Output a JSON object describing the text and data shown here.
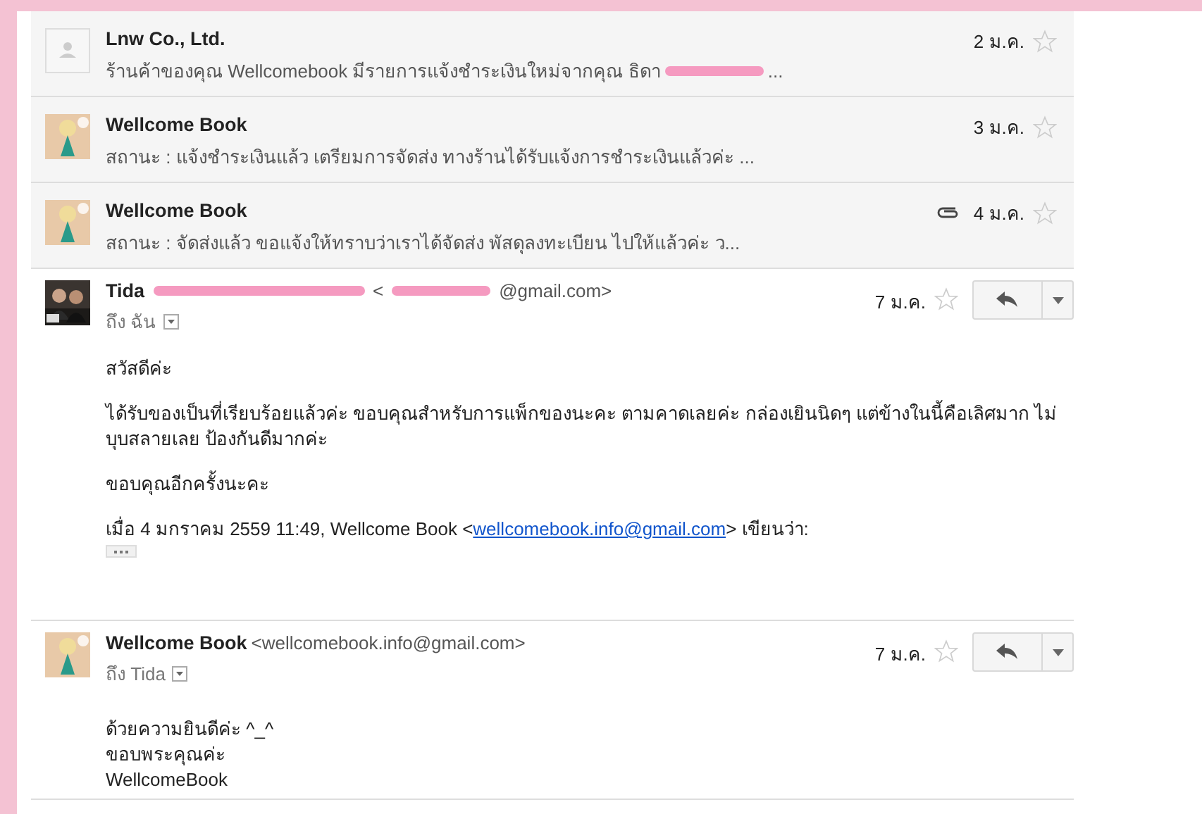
{
  "collapsed": [
    {
      "kind": "placeholder",
      "sender": "Lnw Co., Ltd.",
      "snippet_parts": [
        "ร้านค้าของคุณ Wellcomebook มีรายการแจ้งชำระเงินใหม่จากคุณ ธิดา",
        "..."
      ],
      "attachment": false,
      "date": "2 ม.ค.",
      "starred": false
    },
    {
      "kind": "character",
      "sender": "Wellcome Book",
      "snippet_parts": [
        "สถานะ : แจ้งชำระเงินแล้ว เตรียมการจัดส่ง ทางร้านได้รับแจ้งการชำระเงินแล้วค่ะ ..."
      ],
      "attachment": false,
      "date": "3 ม.ค.",
      "starred": false
    },
    {
      "kind": "character",
      "sender": "Wellcome Book",
      "snippet_parts": [
        "สถานะ : จัดส่งแล้ว ขอแจ้งให้ทราบว่าเราได้จัดส่ง พัสดุลงทะเบียน ไปให้แล้วค่ะ ว..."
      ],
      "attachment": true,
      "date": "4 ม.ค.",
      "starred": false
    }
  ],
  "expanded": [
    {
      "sender": "Tida",
      "sender_redacted": true,
      "email_parts": [
        "<",
        "@gmail.com>"
      ],
      "recipient": "ถึง ฉัน",
      "date": "7 ม.ค.",
      "starred": false,
      "paragraphs": [
        [
          "สวัสดีค่ะ"
        ],
        [
          "ได้รับของเป็นที่เรียบร้อยแล้วค่ะ ขอบคุณสำหรับการแพ็กของนะคะ ตามคาดเลยค่ะ กล่องเยินนิดๆ แต่ข้างในนี้คือเลิศมาก ไม่บุบสลายเลย ป้องกันดีมากค่ะ"
        ],
        [
          "ขอบคุณอีกครั้งนะคะ"
        ]
      ],
      "quote": {
        "before": "เมื่อ 4 มกราคม 2559 11:49, Wellcome Book <",
        "link": "wellcomebook.info@gmail.com",
        "after": "> เขียนว่า:"
      }
    },
    {
      "kind": "character",
      "sender": "Wellcome Book",
      "sender_redacted": false,
      "email_parts": [
        "<wellcomebook.info@gmail.com>"
      ],
      "recipient": "ถึง Tida",
      "date": "7 ม.ค.",
      "starred": false,
      "paragraphs": [
        [
          "ด้วยความยินดีค่ะ ^_^",
          "ขอบพระคุณค่ะ",
          "WellcomeBook"
        ]
      ]
    }
  ]
}
